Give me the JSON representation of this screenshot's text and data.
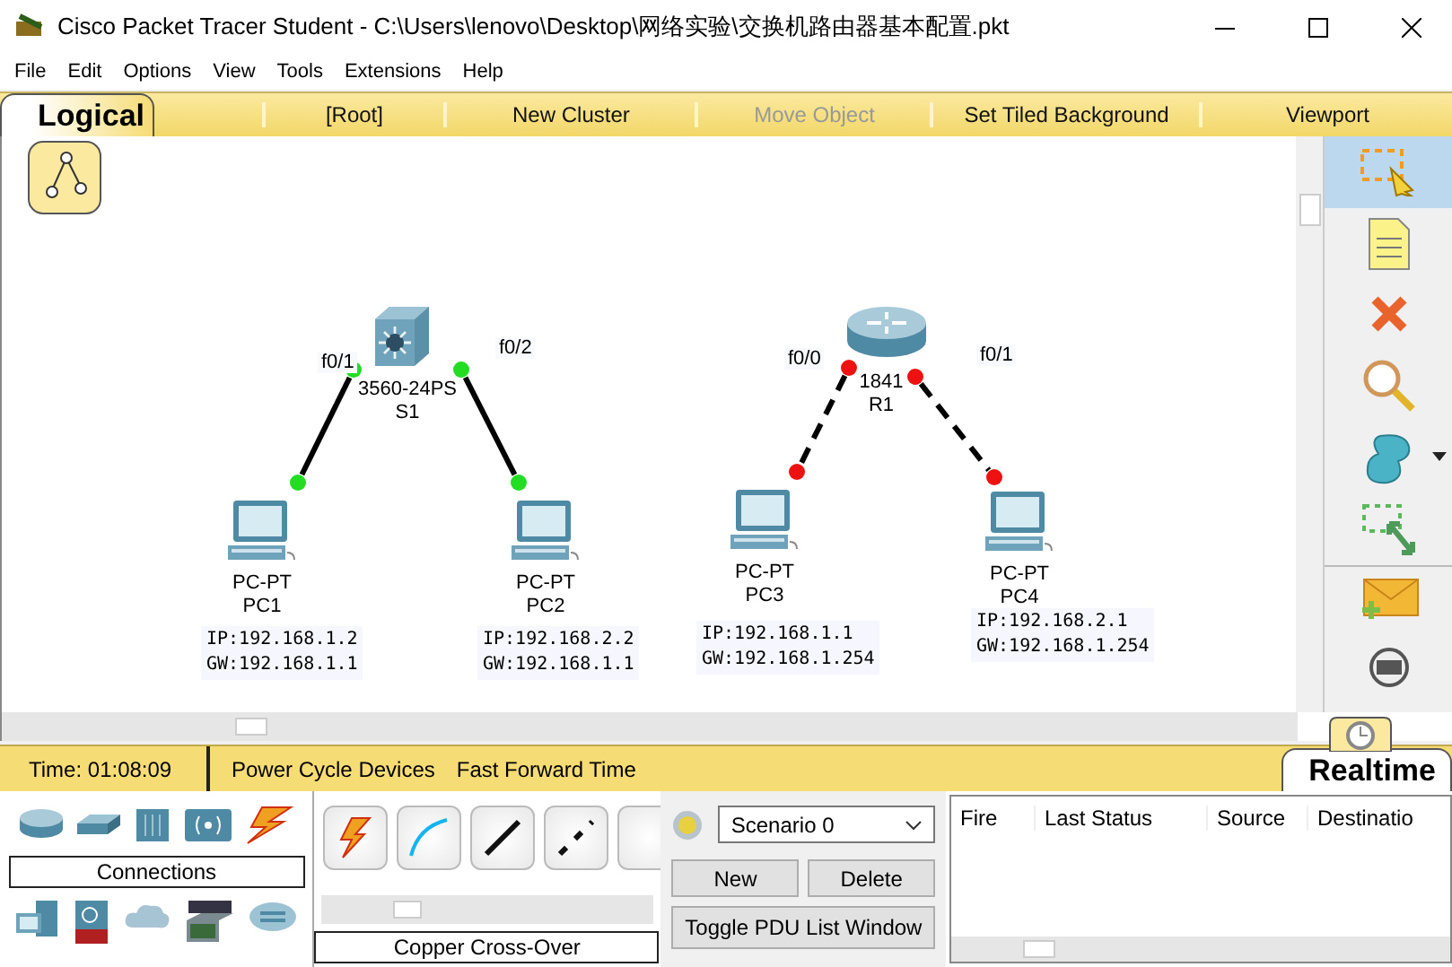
{
  "window": {
    "title": "Cisco Packet Tracer Student - C:\\Users\\lenovo\\Desktop\\网络实验\\交换机路由器基本配置.pkt"
  },
  "menu": [
    "File",
    "Edit",
    "Options",
    "View",
    "Tools",
    "Extensions",
    "Help"
  ],
  "workspace_bar": {
    "mode_tab": "Logical",
    "items": [
      {
        "label": "[Root]",
        "disabled": false
      },
      {
        "label": "New Cluster",
        "disabled": false
      },
      {
        "label": "Move Object",
        "disabled": true
      },
      {
        "label": "Set Tiled Background",
        "disabled": false
      },
      {
        "label": "Viewport",
        "disabled": false
      }
    ]
  },
  "topology": [
    {
      "kind": "switch",
      "model": "3560-24PS",
      "name": "S1",
      "children": [
        {
          "kind": "pc",
          "model": "PC-PT",
          "name": "PC1",
          "port": "f0/1",
          "link": {
            "kind": "straight",
            "up": true
          },
          "note": [
            "IP:192.168.1.2",
            "GW:192.168.1.1"
          ]
        },
        {
          "kind": "pc",
          "model": "PC-PT",
          "name": "PC2",
          "port": "f0/2",
          "link": {
            "kind": "straight",
            "up": true
          },
          "note": [
            "IP:192.168.2.2",
            "GW:192.168.1.1"
          ]
        }
      ]
    },
    {
      "kind": "router",
      "model": "1841",
      "name": "R1",
      "children": [
        {
          "kind": "pc",
          "model": "PC-PT",
          "name": "PC3",
          "port": "f0/0",
          "link": {
            "kind": "cross",
            "up": false
          },
          "note": [
            "IP:192.168.1.1",
            "GW:192.168.1.254"
          ]
        },
        {
          "kind": "pc",
          "model": "PC-PT",
          "name": "PC4",
          "port": "f0/1",
          "link": {
            "kind": "cross",
            "up": false
          },
          "note": [
            "IP:192.168.2.1",
            "GW:192.168.1.254"
          ]
        }
      ]
    }
  ],
  "tools": [
    {
      "kind": "select",
      "selected": true
    },
    {
      "kind": "note",
      "selected": false
    },
    {
      "kind": "delete",
      "selected": false
    },
    {
      "kind": "inspect",
      "selected": false
    },
    {
      "kind": "shape",
      "selected": false
    },
    {
      "kind": "resize",
      "selected": false
    },
    {
      "kind": "pdu",
      "selected": false
    },
    {
      "kind": "complex-pdu",
      "selected": false
    }
  ],
  "status_bar": {
    "time": "Time: 01:08:09",
    "actions": [
      "Power Cycle Devices",
      "Fast Forward Time"
    ],
    "mode_tab": "Realtime"
  },
  "device_palette": {
    "categories": [
      {
        "kind": "router"
      },
      {
        "kind": "switch"
      },
      {
        "kind": "hub"
      },
      {
        "kind": "wireless"
      },
      {
        "kind": "connections"
      }
    ],
    "category_label": "Connections",
    "subcategories": [
      {
        "kind": "end-devices"
      },
      {
        "kind": "security"
      },
      {
        "kind": "wan"
      },
      {
        "kind": "custom"
      },
      {
        "kind": "multiuser"
      }
    ]
  },
  "connection_types": {
    "items": [
      {
        "kind": "automatic"
      },
      {
        "kind": "console"
      },
      {
        "kind": "straight"
      },
      {
        "kind": "cross"
      }
    ],
    "label": "Copper Cross-Over"
  },
  "scenario": {
    "value": "Scenario 0",
    "buttons": [
      "New",
      "Delete",
      "Toggle PDU List Window"
    ]
  },
  "pdu_table": {
    "columns": [
      "Fire",
      "Last Status",
      "Source",
      "Destinatio"
    ]
  }
}
